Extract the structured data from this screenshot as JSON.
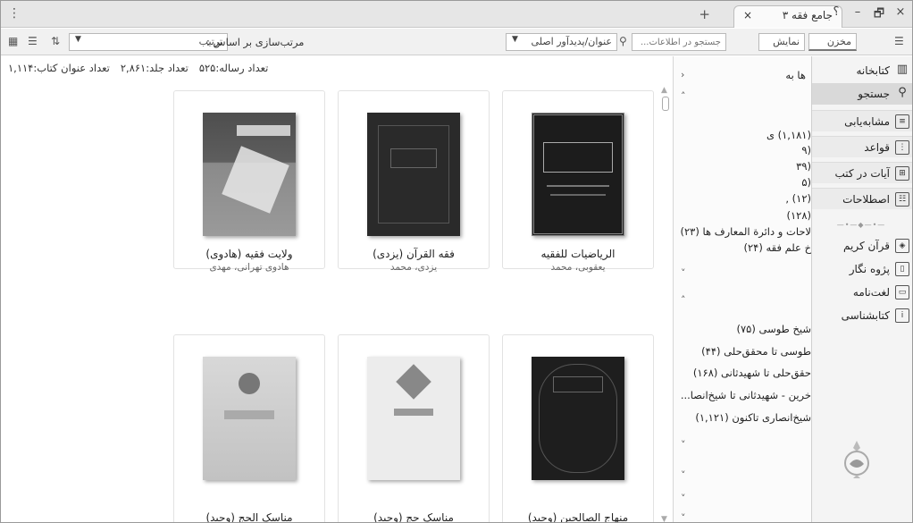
{
  "window": {
    "tab_title": "جامع فقه ۳",
    "tab_close": "×",
    "new_tab": "+",
    "controls": [
      "؟",
      "–",
      "🗗",
      "×"
    ]
  },
  "toolbar": {
    "store_label": "مخزن",
    "display_label": "نمایش",
    "search_placeholder": "جستجو در اطلاعات...",
    "search_field_select": "عنوان/پدیدآور اصلی",
    "sort_label": "مرتب‌سازی بر اساس :",
    "sort_value": "ترتیب"
  },
  "stats": {
    "titles": "تعداد عنوان کتاب:۱,۱۱۴",
    "volumes": "تعداد جلد:۲,۸۶۱",
    "treatises": "تعداد رساله:۵۲۵"
  },
  "books": [
    {
      "title": "الریاضیات للفقیه",
      "author": "یعقوبی، محمد",
      "cover_color": "#1c1c1c"
    },
    {
      "title": "فقه القرآن (یزدی)",
      "author": "یزدی، محمد",
      "cover_color": "#2a2a2a"
    },
    {
      "title": "ولایت فقیه (هادوی)",
      "author": "هادوی تهرانی، مهدی",
      "cover_color": "#6a6a6a"
    },
    {
      "title": "منهاج الصالحین (وحید)",
      "author": "",
      "cover_color": "#1e1e1e"
    },
    {
      "title": "مناسک حج (وحید)",
      "author": "",
      "cover_color": "#e4e4e4"
    },
    {
      "title": "مناسک الحج (وحید)",
      "author": "",
      "cover_color": "#cfcfcf"
    }
  ],
  "filter_panel": {
    "header": "ها به",
    "group1": [
      "(۱,۱۸۱) ی",
      "(۹",
      "(۳۹",
      "(۵",
      "(۱۲) ,",
      "(۱۲۸)",
      "لاحات و دائرة المعارف ها (۲۳)",
      "خ علم فقه (۲۴)"
    ],
    "group2": [
      "شیخ طوسی (۷۵)",
      "طوسی تا محقق‌حلی (۴۴)",
      "حقق‌حلی تا شهیدثانی (۱۶۸)",
      "خرین - شهیدثانی تا شیخ‌انصا...",
      "شیخ‌انصاری تاکنون (۱,۱۲۱)"
    ]
  },
  "sidebar": {
    "items": [
      {
        "label": "کتابخانه",
        "icon": "library-icon"
      },
      {
        "label": "جستجو",
        "icon": "search-icon"
      },
      {
        "label": "مشابه‌یابی",
        "icon": "similar-icon"
      },
      {
        "label": "قواعد",
        "icon": "rules-icon"
      },
      {
        "label": "آیات در کتب",
        "icon": "verses-icon"
      },
      {
        "label": "اصطلاحات",
        "icon": "terms-icon"
      }
    ],
    "tools": [
      {
        "label": "قرآن کریم",
        "icon": "quran-icon"
      },
      {
        "label": "پژوه نگار",
        "icon": "notes-icon"
      },
      {
        "label": "لغت‌نامه",
        "icon": "dictionary-icon"
      },
      {
        "label": "کتابشناسی",
        "icon": "bibliography-icon"
      }
    ]
  }
}
